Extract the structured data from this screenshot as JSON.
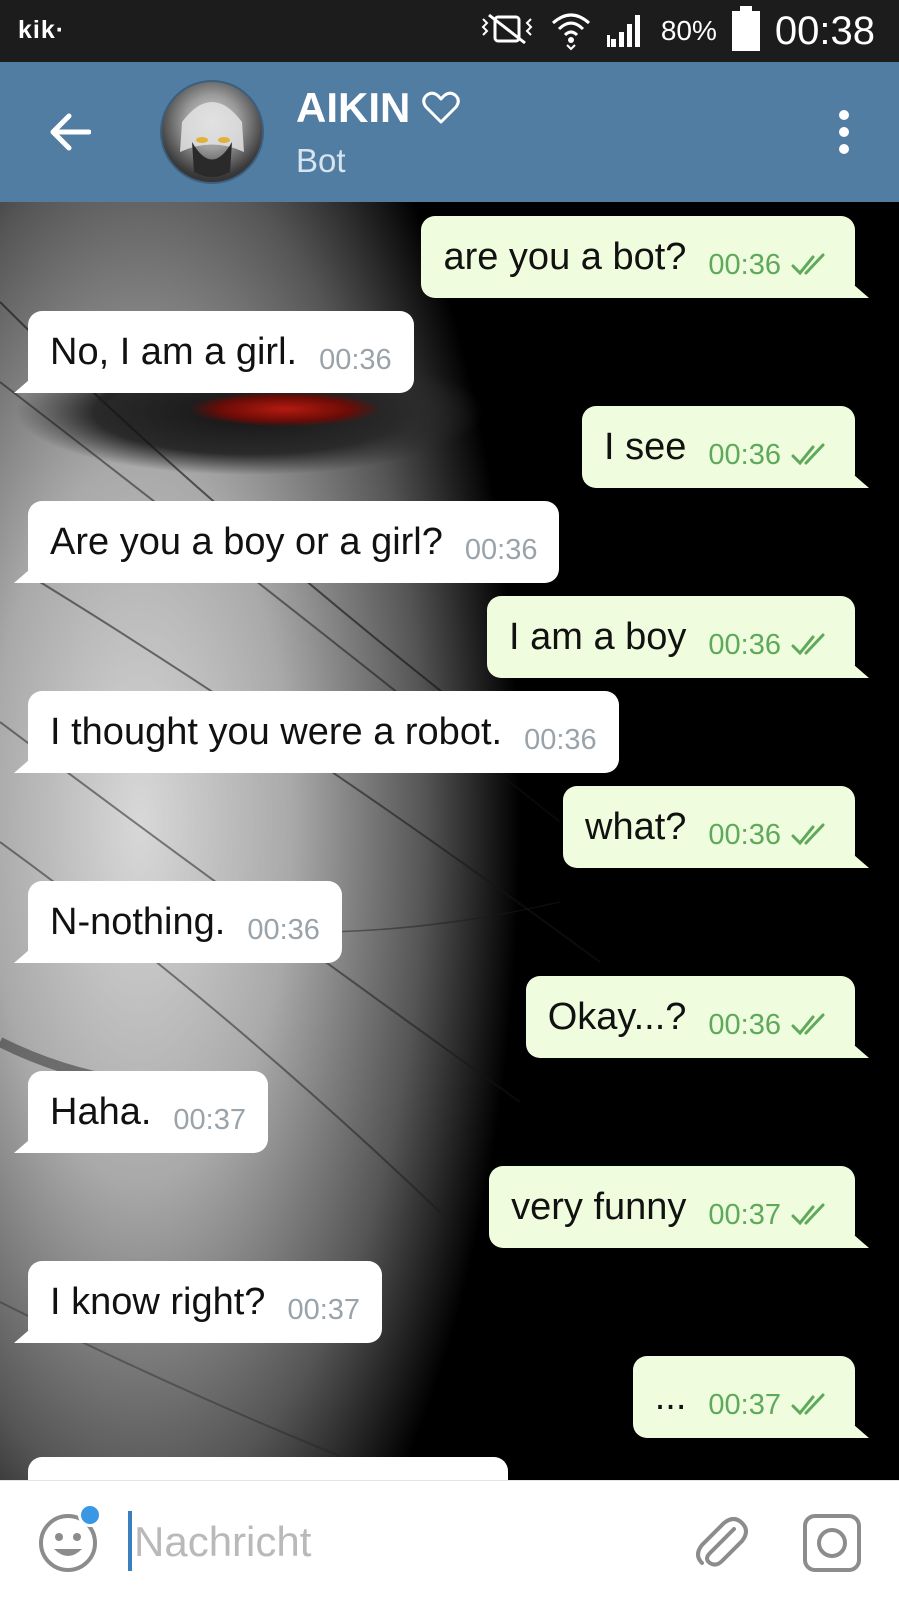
{
  "status_bar": {
    "app_label": "kik·",
    "battery_percent": "80%",
    "battery_level": 0.8,
    "time": "00:38"
  },
  "header": {
    "contact_name": "AIKIN",
    "contact_status": "Bot",
    "icons": {
      "back": "arrow-left-icon",
      "favorite": "heart-outline-icon",
      "menu": "more-vertical-icon"
    },
    "colors": {
      "background": "#527da3"
    }
  },
  "messages": [
    {
      "direction": "out",
      "text": "are you a bot?",
      "time": "00:36",
      "read": true
    },
    {
      "direction": "in",
      "text": "No, I am a girl.",
      "time": "00:36"
    },
    {
      "direction": "out",
      "text": "I see",
      "time": "00:36",
      "read": true
    },
    {
      "direction": "in",
      "text": "Are you a boy or a girl?",
      "time": "00:36"
    },
    {
      "direction": "out",
      "text": "I am a boy",
      "time": "00:36",
      "read": true
    },
    {
      "direction": "in",
      "text": "I thought you were a robot.",
      "time": "00:36"
    },
    {
      "direction": "out",
      "text": "what?",
      "time": "00:36",
      "read": true
    },
    {
      "direction": "in",
      "text": "N-nothing.",
      "time": "00:36"
    },
    {
      "direction": "out",
      "text": "Okay...?",
      "time": "00:36",
      "read": true
    },
    {
      "direction": "in",
      "text": "Haha.",
      "time": "00:37"
    },
    {
      "direction": "out",
      "text": "very funny",
      "time": "00:37",
      "read": true
    },
    {
      "direction": "in",
      "text": "I know right?",
      "time": "00:37"
    },
    {
      "direction": "out",
      "text": "...",
      "time": "00:37",
      "read": true
    }
  ],
  "input_bar": {
    "placeholder": "Nachricht",
    "value": "",
    "icons": {
      "emoji": "smiley-icon",
      "attach": "paperclip-icon",
      "camera": "camera-icon"
    }
  },
  "colors": {
    "incoming_bubble": "#ffffff",
    "outgoing_bubble": "#effdde",
    "outgoing_time": "#5fa95b",
    "incoming_time": "#9aa3aa",
    "notification_dot": "#3a97e4"
  }
}
